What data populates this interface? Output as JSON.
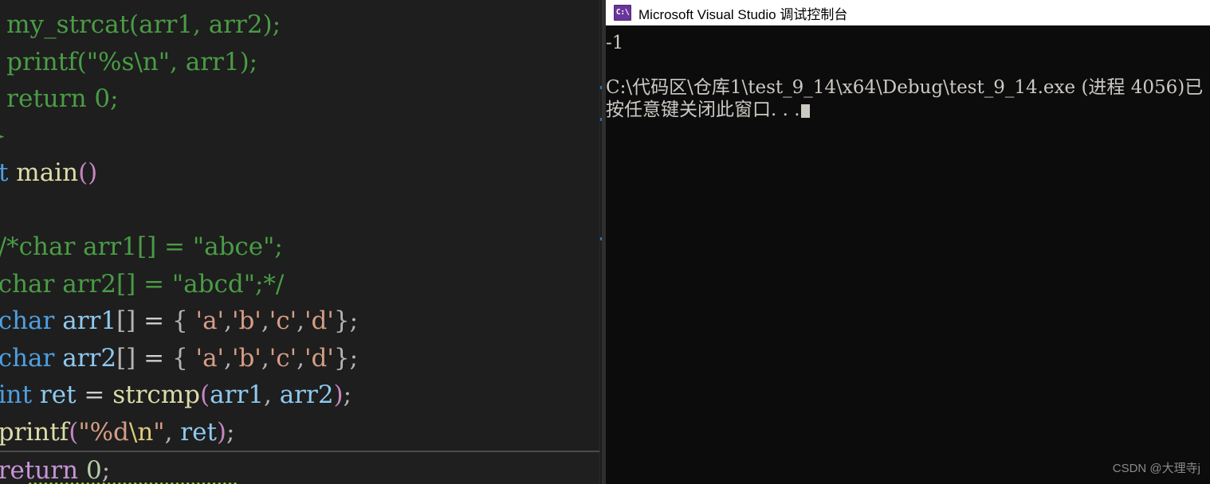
{
  "editor": {
    "name": "code-editor",
    "background": "#1e1e1e",
    "lines": [
      {
        "id": "line-my-strcat-call",
        "current": false,
        "tokens": [
          {
            "text": "/",
            "cls": "t-cm"
          },
          {
            "text": "  my_strcat(arr1, arr2);",
            "cls": "t-cm"
          }
        ]
      },
      {
        "id": "line-printf-arr1",
        "current": false,
        "tokens": [
          {
            "text": "/",
            "cls": "t-cm"
          },
          {
            "text": "  printf(\"%s\\n\", arr1);",
            "cls": "t-cm"
          }
        ]
      },
      {
        "id": "line-return-zero-commented",
        "current": false,
        "tokens": [
          {
            "text": "/",
            "cls": "t-cm"
          },
          {
            "text": "  return 0;",
            "cls": "t-cm"
          }
        ]
      },
      {
        "id": "line-close-brace-commented",
        "current": false,
        "tokens": [
          {
            "text": "/}",
            "cls": "t-cm"
          }
        ]
      },
      {
        "id": "line-int-main",
        "current": false,
        "tokens": [
          {
            "text": "nt",
            "cls": "t-kw"
          },
          {
            "text": " ",
            "cls": "t-op"
          },
          {
            "text": "main",
            "cls": "t-fn"
          },
          {
            "text": "()",
            "cls": "t-par"
          }
        ]
      },
      {
        "id": "line-blank-1",
        "current": false,
        "tokens": [
          {
            "text": " ",
            "cls": "t-op"
          }
        ]
      },
      {
        "id": "line-comment-arr1-abce",
        "current": false,
        "tokens": [
          {
            "text": "  /*char arr1[] = \"abce\";",
            "cls": "t-cm"
          }
        ]
      },
      {
        "id": "line-comment-arr2-abcd",
        "current": false,
        "tokens": [
          {
            "text": "  char arr2[] = \"abcd\";*/",
            "cls": "t-cm"
          }
        ]
      },
      {
        "id": "line-char-arr1-init",
        "current": false,
        "tokens": [
          {
            "text": "  ",
            "cls": "t-op"
          },
          {
            "text": "char",
            "cls": "t-kw"
          },
          {
            "text": " ",
            "cls": "t-op"
          },
          {
            "text": "arr1",
            "cls": "t-var"
          },
          {
            "text": "[]",
            "cls": "t-pun"
          },
          {
            "text": " = ",
            "cls": "t-op"
          },
          {
            "text": "{",
            "cls": "t-pun"
          },
          {
            "text": " 'a'",
            "cls": "t-str"
          },
          {
            "text": ",",
            "cls": "t-pun"
          },
          {
            "text": "'b'",
            "cls": "t-str"
          },
          {
            "text": ",",
            "cls": "t-pun"
          },
          {
            "text": "'c'",
            "cls": "t-str"
          },
          {
            "text": ",",
            "cls": "t-pun"
          },
          {
            "text": "'d'",
            "cls": "t-str"
          },
          {
            "text": "};",
            "cls": "t-pun"
          }
        ]
      },
      {
        "id": "line-char-arr2-init",
        "current": false,
        "tokens": [
          {
            "text": "  ",
            "cls": "t-op"
          },
          {
            "text": "char",
            "cls": "t-kw"
          },
          {
            "text": " ",
            "cls": "t-op"
          },
          {
            "text": "arr2",
            "cls": "t-var"
          },
          {
            "text": "[]",
            "cls": "t-pun"
          },
          {
            "text": " = ",
            "cls": "t-op"
          },
          {
            "text": "{",
            "cls": "t-pun"
          },
          {
            "text": " 'a'",
            "cls": "t-str"
          },
          {
            "text": ",",
            "cls": "t-pun"
          },
          {
            "text": "'b'",
            "cls": "t-str"
          },
          {
            "text": ",",
            "cls": "t-pun"
          },
          {
            "text": "'c'",
            "cls": "t-str"
          },
          {
            "text": ",",
            "cls": "t-pun"
          },
          {
            "text": "'d'",
            "cls": "t-str"
          },
          {
            "text": "};",
            "cls": "t-pun"
          }
        ]
      },
      {
        "id": "line-int-ret-strcmp",
        "current": false,
        "squiggle": true,
        "tokens": [
          {
            "text": "  ",
            "cls": "t-op"
          },
          {
            "text": "int",
            "cls": "t-kw"
          },
          {
            "text": " ",
            "cls": "t-op"
          },
          {
            "text": "ret",
            "cls": "t-var"
          },
          {
            "text": " = ",
            "cls": "t-op"
          },
          {
            "text": "strcmp",
            "cls": "t-fn"
          },
          {
            "text": "(",
            "cls": "t-par"
          },
          {
            "text": "arr1",
            "cls": "t-var"
          },
          {
            "text": ", ",
            "cls": "t-pun"
          },
          {
            "text": "arr2",
            "cls": "t-var"
          },
          {
            "text": ")",
            "cls": "t-par"
          },
          {
            "text": ";",
            "cls": "t-pun"
          }
        ]
      },
      {
        "id": "line-printf-ret",
        "current": false,
        "tokens": [
          {
            "text": "  ",
            "cls": "t-op"
          },
          {
            "text": "printf",
            "cls": "t-fn"
          },
          {
            "text": "(",
            "cls": "t-par"
          },
          {
            "text": "\"%d",
            "cls": "t-str"
          },
          {
            "text": "\\n",
            "cls": "t-esc"
          },
          {
            "text": "\"",
            "cls": "t-str"
          },
          {
            "text": ", ",
            "cls": "t-pun"
          },
          {
            "text": "ret",
            "cls": "t-var"
          },
          {
            "text": ")",
            "cls": "t-par"
          },
          {
            "text": ";",
            "cls": "t-pun"
          }
        ]
      },
      {
        "id": "line-return-zero",
        "current": true,
        "tokens": [
          {
            "text": "  ",
            "cls": "t-op"
          },
          {
            "text": "return",
            "cls": "t-kw2"
          },
          {
            "text": " ",
            "cls": "t-op"
          },
          {
            "text": "0",
            "cls": "t-num"
          },
          {
            "text": ";",
            "cls": "t-pun"
          }
        ]
      }
    ],
    "scrollbar": {
      "name": "editor-vertical-scrollbar",
      "marks": [
        108,
        148,
        298
      ]
    }
  },
  "console": {
    "title": "Microsoft Visual Studio 调试控制台",
    "icon": "console-icon",
    "icon_glyph": "C:\\",
    "output": [
      "-1",
      "",
      "C:\\代码区\\仓库1\\test_9_14\\x64\\Debug\\test_9_14.exe (进程 4056)已",
      "按任意键关闭此窗口. . ."
    ],
    "background": "#0c0c0c",
    "text_color": "#ccc9c3"
  },
  "watermark": {
    "text": "CSDN @大理寺j"
  },
  "colors": {
    "editor_background": "#1e1e1e",
    "console_background": "#0c0c0c",
    "titlebar_background": "#ffffff",
    "comment_green": "#4a9c45",
    "keyword_blue": "#4f9fe0",
    "keyword_magenta": "#c994d8",
    "identifier_blue": "#8fc9f0",
    "function_gold": "#dcdcaa",
    "string_orange": "#d69d85",
    "number_green": "#b5cea8",
    "squiggle_green": "#9acd32",
    "icon_purple": "#6a359c"
  }
}
